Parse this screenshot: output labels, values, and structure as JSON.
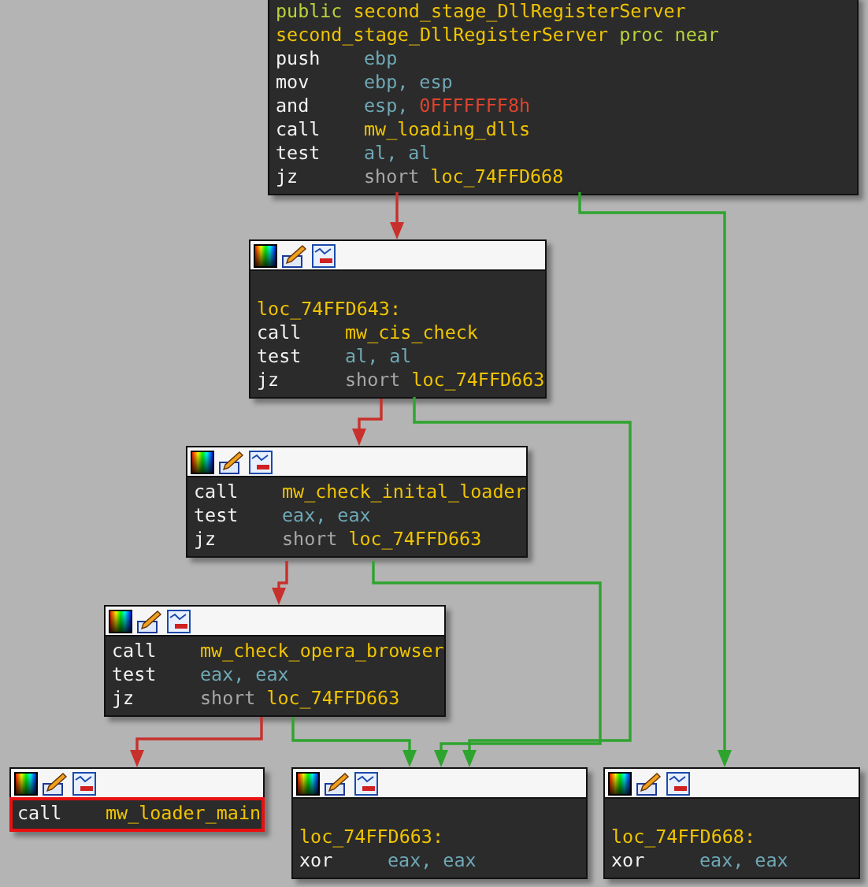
{
  "blocks": [
    {
      "header": false,
      "highlighted": false,
      "lines": [
        [
          {
            "t": "public",
            "kind": "keyword"
          },
          {
            "t": "second_stage_DllRegisterServer",
            "kind": "name"
          }
        ],
        [
          {
            "t": "second_stage_DllRegisterServer",
            "kind": "name"
          },
          {
            "t": "proc near",
            "kind": "keyword"
          }
        ],
        [
          {
            "t": "push",
            "kind": "mnemonic"
          },
          {
            "t": "ebp",
            "kind": "register"
          }
        ],
        [
          {
            "t": "mov",
            "kind": "mnemonic"
          },
          {
            "t": "ebp, esp",
            "kind": "register"
          }
        ],
        [
          {
            "t": "and",
            "kind": "mnemonic"
          },
          {
            "t": "esp,",
            "kind": "register"
          },
          {
            "t": "0FFFFFFF8h",
            "kind": "number"
          }
        ],
        [
          {
            "t": "call",
            "kind": "mnemonic"
          },
          {
            "t": "mw_loading_dlls",
            "kind": "name"
          }
        ],
        [
          {
            "t": "test",
            "kind": "mnemonic"
          },
          {
            "t": "al, al",
            "kind": "register"
          }
        ],
        [
          {
            "t": "jz",
            "kind": "mnemonic"
          },
          {
            "t": "short",
            "kind": "modifier"
          },
          {
            "t": "loc_74FFD668",
            "kind": "name"
          }
        ]
      ]
    },
    {
      "header": true,
      "highlighted": false,
      "label": "loc_74FFD643:",
      "lines": [
        [
          {
            "t": "call",
            "kind": "mnemonic"
          },
          {
            "t": "mw_cis_check",
            "kind": "name"
          }
        ],
        [
          {
            "t": "test",
            "kind": "mnemonic"
          },
          {
            "t": "al, al",
            "kind": "register"
          }
        ],
        [
          {
            "t": "jz",
            "kind": "mnemonic"
          },
          {
            "t": "short",
            "kind": "modifier"
          },
          {
            "t": "loc_74FFD663",
            "kind": "name"
          }
        ]
      ]
    },
    {
      "header": true,
      "highlighted": false,
      "lines": [
        [
          {
            "t": "call",
            "kind": "mnemonic"
          },
          {
            "t": "mw_check_inital_loader",
            "kind": "name"
          }
        ],
        [
          {
            "t": "test",
            "kind": "mnemonic"
          },
          {
            "t": "eax, eax",
            "kind": "register"
          }
        ],
        [
          {
            "t": "jz",
            "kind": "mnemonic"
          },
          {
            "t": "short",
            "kind": "modifier"
          },
          {
            "t": "loc_74FFD663",
            "kind": "name"
          }
        ]
      ]
    },
    {
      "header": true,
      "highlighted": false,
      "lines": [
        [
          {
            "t": "call",
            "kind": "mnemonic"
          },
          {
            "t": "mw_check_opera_browser",
            "kind": "name"
          }
        ],
        [
          {
            "t": "test",
            "kind": "mnemonic"
          },
          {
            "t": "eax, eax",
            "kind": "register"
          }
        ],
        [
          {
            "t": "jz",
            "kind": "mnemonic"
          },
          {
            "t": "short",
            "kind": "modifier"
          },
          {
            "t": "loc_74FFD663",
            "kind": "name"
          }
        ]
      ]
    },
    {
      "header": true,
      "highlighted": true,
      "lines": [
        [
          {
            "t": "call",
            "kind": "mnemonic"
          },
          {
            "t": "mw_loader_main",
            "kind": "name"
          }
        ]
      ]
    },
    {
      "header": true,
      "highlighted": false,
      "label": "loc_74FFD663:",
      "lines": [
        [
          {
            "t": "xor",
            "kind": "mnemonic"
          },
          {
            "t": "eax, eax",
            "kind": "register"
          }
        ]
      ]
    },
    {
      "header": true,
      "highlighted": false,
      "label": "loc_74FFD668:",
      "lines": [
        [
          {
            "t": "xor",
            "kind": "mnemonic"
          },
          {
            "t": "eax, eax",
            "kind": "register"
          }
        ]
      ]
    }
  ],
  "edges": [
    {
      "color": "#c8302c"
    },
    {
      "color": "#2ea42e"
    },
    {
      "color": "#c8302c"
    },
    {
      "color": "#2ea42e"
    },
    {
      "color": "#c8302c"
    },
    {
      "color": "#2ea42e"
    },
    {
      "color": "#c8302c"
    },
    {
      "color": "#2ea42e"
    }
  ]
}
